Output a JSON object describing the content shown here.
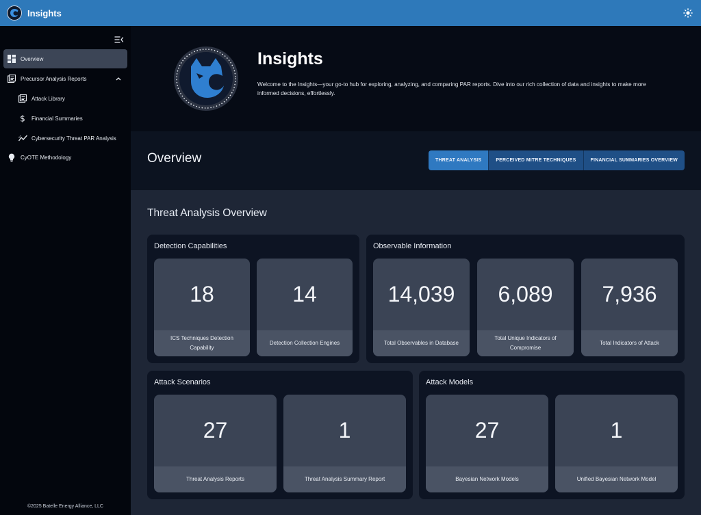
{
  "app": {
    "title": "Insights",
    "accent": "#2e79ba",
    "logo_icon": "cyote-wolf-logo",
    "theme_icon": "sun-icon"
  },
  "sidebar": {
    "collapse_icon": "collapse-menu-icon",
    "items": [
      {
        "label": "Overview",
        "icon": "dashboard-icon",
        "active": true
      },
      {
        "label": "Precursor Analysis Reports",
        "icon": "reports-icon",
        "expanded": true
      },
      {
        "label": "Attack Library",
        "icon": "library-icon"
      },
      {
        "label": "Financial Summaries",
        "icon": "dollar-icon"
      },
      {
        "label": "Cybersecurity Threat PAR Analysis",
        "icon": "trend-line-icon"
      },
      {
        "label": "CyOTE Methodology",
        "icon": "lightbulb-icon"
      }
    ],
    "copyright": "©2025 Batelle Energy Alliance, LLC"
  },
  "hero": {
    "title": "Insights",
    "description": "Welcome to the Insights—your go-to hub for exploring, analyzing, and comparing PAR reports. Dive into our rich collection of data and insights to make more informed decisions, effortlessly."
  },
  "overview": {
    "title": "Overview",
    "tabs": [
      {
        "label": "THREAT ANALYSIS",
        "active": true
      },
      {
        "label": "PERCEIVED MITRE TECHNIQUES",
        "active": false
      },
      {
        "label": "FINANCIAL SUMMARIES OVERVIEW",
        "active": false
      }
    ]
  },
  "main": {
    "section_title": "Threat Analysis Overview",
    "panels": [
      {
        "title": "Detection Capabilities",
        "stats": [
          {
            "value": "18",
            "label": "ICS Techniques Detection Capability"
          },
          {
            "value": "14",
            "label": "Detection Collection Engines"
          }
        ]
      },
      {
        "title": "Observable Information",
        "stats": [
          {
            "value": "14,039",
            "label": "Total Observables in Database"
          },
          {
            "value": "6,089",
            "label": "Total Unique Indicators of Compromise"
          },
          {
            "value": "7,936",
            "label": "Total Indicators of Attack"
          }
        ]
      },
      {
        "title": "Attack Scenarios",
        "stats": [
          {
            "value": "27",
            "label": "Threat Analysis Reports"
          },
          {
            "value": "1",
            "label": "Threat Analysis Summary Report"
          }
        ]
      },
      {
        "title": "Attack Models",
        "stats": [
          {
            "value": "27",
            "label": "Bayesian Network Models"
          },
          {
            "value": "1",
            "label": "Unified Bayesian Network Model"
          }
        ]
      }
    ]
  }
}
